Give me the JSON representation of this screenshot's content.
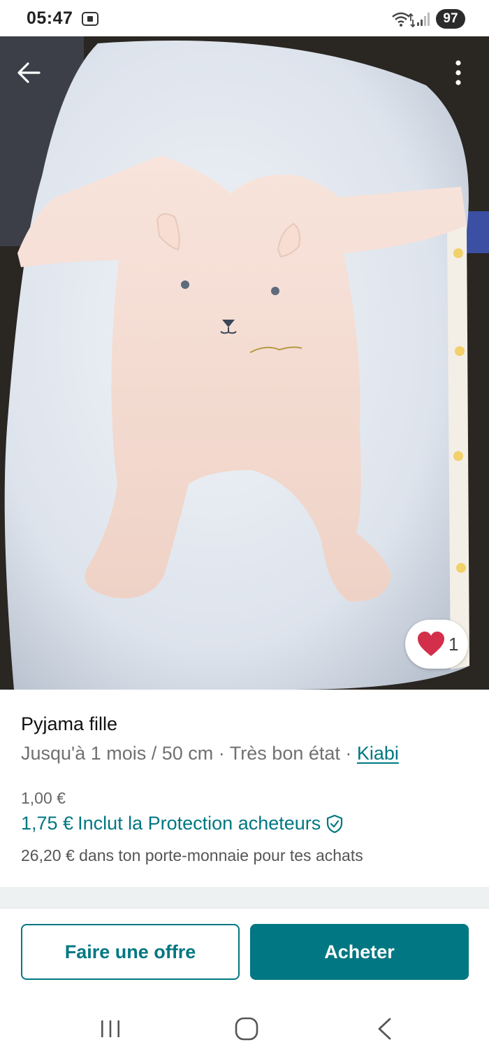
{
  "status_bar": {
    "time": "05:47",
    "battery": "97",
    "icons": [
      "screen-capture-icon",
      "wifi-icon",
      "signal-icon",
      "battery-icon"
    ]
  },
  "photo": {
    "favorite_count": "1",
    "icons": [
      "back-arrow-icon",
      "more-vertical-icon",
      "heart-icon"
    ]
  },
  "item": {
    "title": "Pyjama fille",
    "size": "Jusqu'à 1 mois / 50 cm",
    "separator": " · ",
    "condition": "Très bon état",
    "brand": "Kiabi",
    "price": "1,00 €",
    "price_with_protection": "1,75 €",
    "protection_label": "Inclut la Protection acheteurs",
    "wallet_note": "26,20 € dans ton porte-monnaie pour tes achats"
  },
  "actions": {
    "offer_label": "Faire une offre",
    "buy_label": "Acheter"
  },
  "nav": {
    "icons": [
      "recent-apps-icon",
      "home-icon",
      "system-back-icon"
    ]
  },
  "colors": {
    "accent": "#007782",
    "heart": "#d32f4a",
    "muted_text": "#707070"
  }
}
